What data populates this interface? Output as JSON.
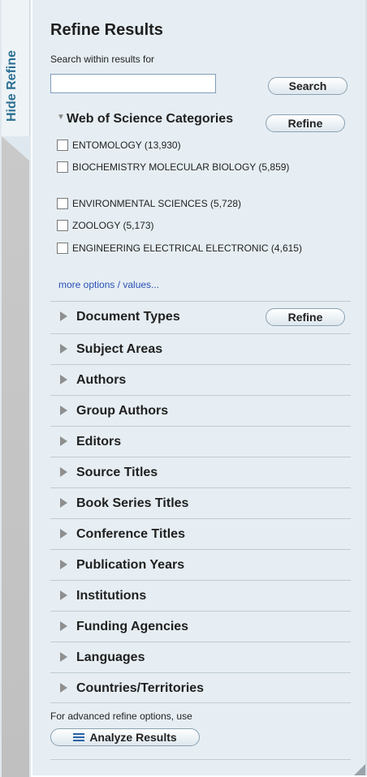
{
  "tab": {
    "label": "Hide Refine"
  },
  "panel": {
    "title": "Refine Results",
    "search_label": "Search within results for",
    "search_value": "",
    "search_button": "Search"
  },
  "categories": {
    "header": "Web of Science Categories",
    "refine_button": "Refine",
    "items": [
      {
        "label": "ENTOMOLOGY (13,930)"
      },
      {
        "label": "BIOCHEMISTRY MOLECULAR BIOLOGY (5,859)"
      },
      {
        "label": "ENVIRONMENTAL SCIENCES (5,728)"
      },
      {
        "label": "ZOOLOGY (5,173)"
      },
      {
        "label": "ENGINEERING ELECTRICAL ELECTRONIC (4,615)"
      }
    ],
    "more_link": "more options / values..."
  },
  "sections": [
    {
      "label": "Document Types",
      "refine_button": "Refine"
    },
    {
      "label": "Subject Areas"
    },
    {
      "label": "Authors"
    },
    {
      "label": "Group Authors"
    },
    {
      "label": "Editors"
    },
    {
      "label": "Source Titles"
    },
    {
      "label": "Book Series Titles"
    },
    {
      "label": "Conference Titles"
    },
    {
      "label": "Publication Years"
    },
    {
      "label": "Institutions"
    },
    {
      "label": "Funding Agencies"
    },
    {
      "label": "Languages"
    },
    {
      "label": "Countries/Territories"
    }
  ],
  "footer": {
    "advanced_text": "For advanced refine options, use",
    "analyze_button": "Analyze Results"
  },
  "colors": {
    "panel_bg": "#e6eef3",
    "tab_text": "#2b6f93",
    "link": "#2a4fb6"
  }
}
